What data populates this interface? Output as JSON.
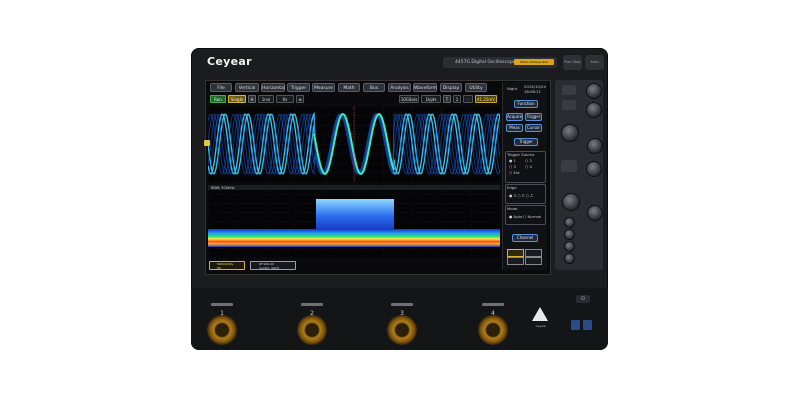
{
  "brand": "Ceyear",
  "model": "4457G Digital Oscilloscope",
  "model_badge": "8GHz 20GSa/s 8bit",
  "top_keys": [
    "Run Stop",
    "Auto"
  ],
  "menu": [
    "File",
    "Vertical",
    "Horizontal",
    "Trigger",
    "Measure",
    "Math",
    "Bus",
    "Analysis",
    "Waveform",
    "Display",
    "Utility"
  ],
  "controls": {
    "run": "Run",
    "single": "Single",
    "h": "H",
    "time": "1ns/",
    "offset": "0s",
    "sample_rate": "10GSa/s",
    "sample_depth": "1kpts",
    "t": "T",
    "trig_level": "41.25mV"
  },
  "side": {
    "time_label": "Night",
    "date": "2024/10/24",
    "clock": "18:08:21",
    "buttons": [
      "Function",
      "Acquire",
      "Trigger",
      "Meas",
      "Cursor",
      "Trigger"
    ],
    "trigger_source_title": "Trigger Source",
    "sources": [
      "1",
      "2",
      "3",
      "4",
      "Ext"
    ],
    "edge_title": "Edge",
    "mode_title": "Mode",
    "mode_auto": "Auto",
    "mode_normal": "Normal",
    "channel_btn": "Channel"
  },
  "spectrum_label": "RBW: 500kHz",
  "bottom_info": {
    "ch1": "500mV/div",
    "ch1b": "0V",
    "ch2": "RF:900.00",
    "ch2b": "Center: 4GHz"
  },
  "channels": [
    "1",
    "2",
    "3",
    "4"
  ],
  "logo_text": "Ceyear"
}
